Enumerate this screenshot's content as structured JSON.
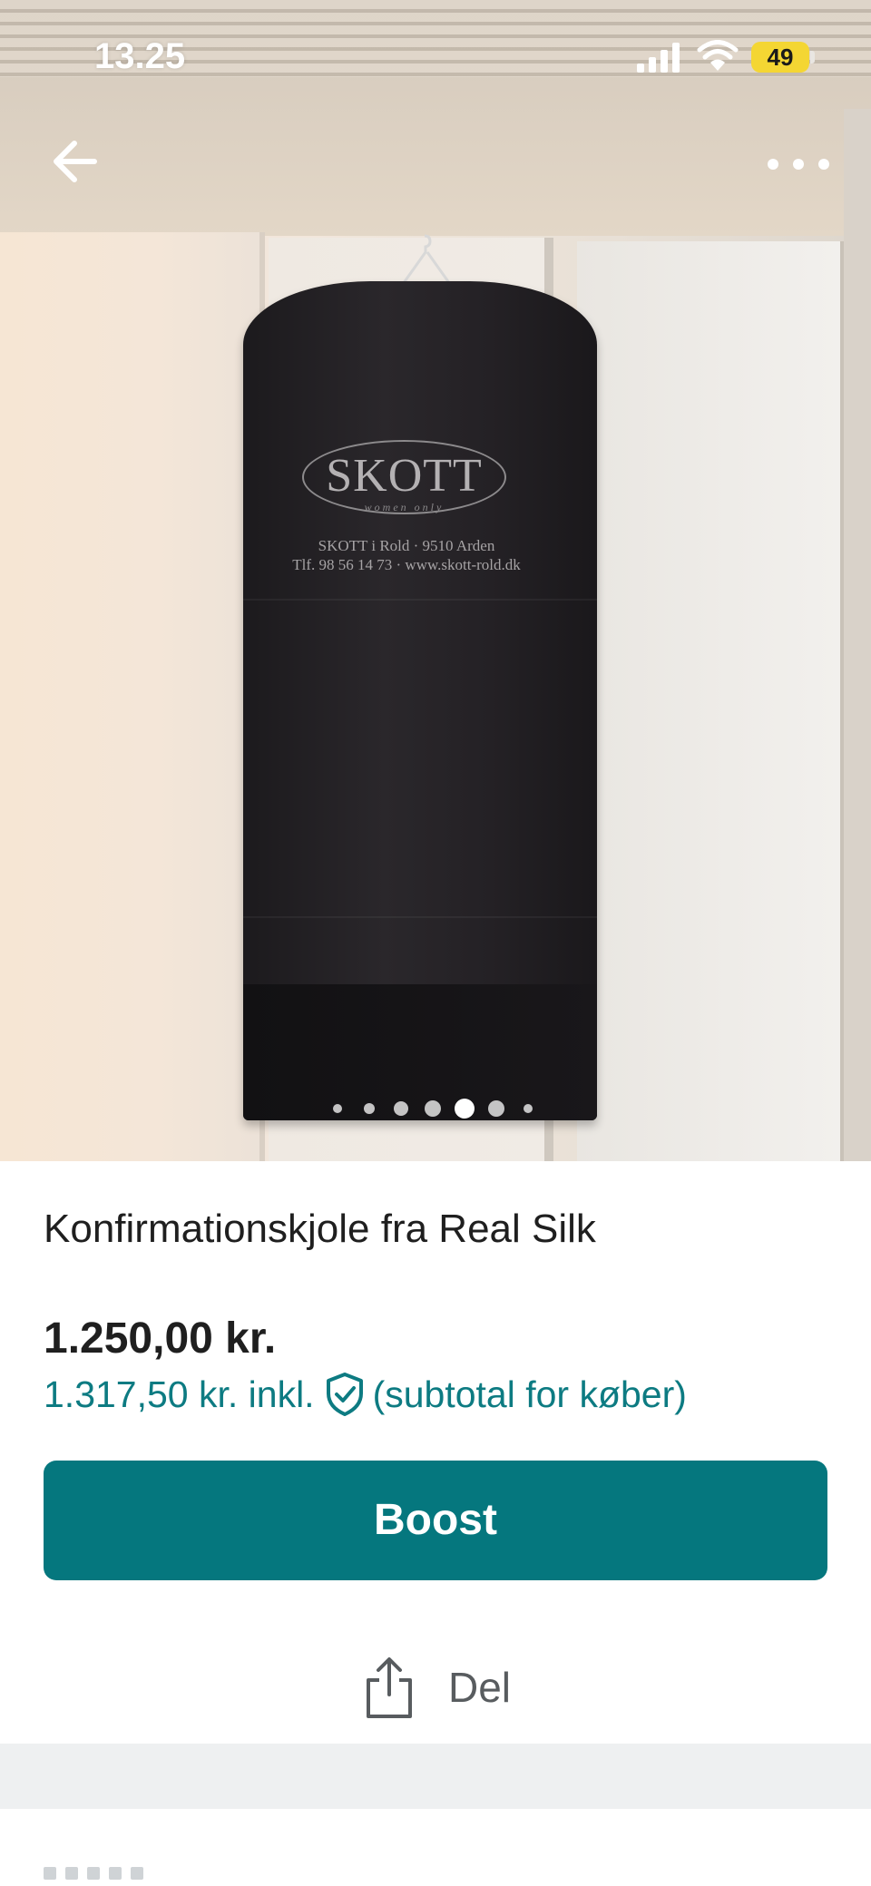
{
  "status_bar": {
    "time": "13.25",
    "battery": "49",
    "battery_color": "#f4d633"
  },
  "photo": {
    "bag_brand": "SKOTT",
    "bag_tagline": "women only",
    "bag_address_line": "SKOTT i Rold · 9510 Arden",
    "bag_contact_line": "Tlf. 98 56 14 73 · www.skott-rold.dk",
    "carousel_count": 7,
    "carousel_active_index": 4
  },
  "nav": {
    "back_icon": "arrow-left-icon",
    "more_icon": "more-horizontal-icon"
  },
  "listing": {
    "title": "Konfirmationskjole fra Real Silk",
    "price": "1.250,00 kr.",
    "price_incl": "1.317,50 kr. inkl.",
    "price_incl_suffix": "(subtotal for køber)",
    "protection_icon": "shield-check-icon",
    "accent_color": "#05777e"
  },
  "actions": {
    "boost_label": "Boost",
    "share_label": "Del",
    "share_icon": "share-icon"
  }
}
